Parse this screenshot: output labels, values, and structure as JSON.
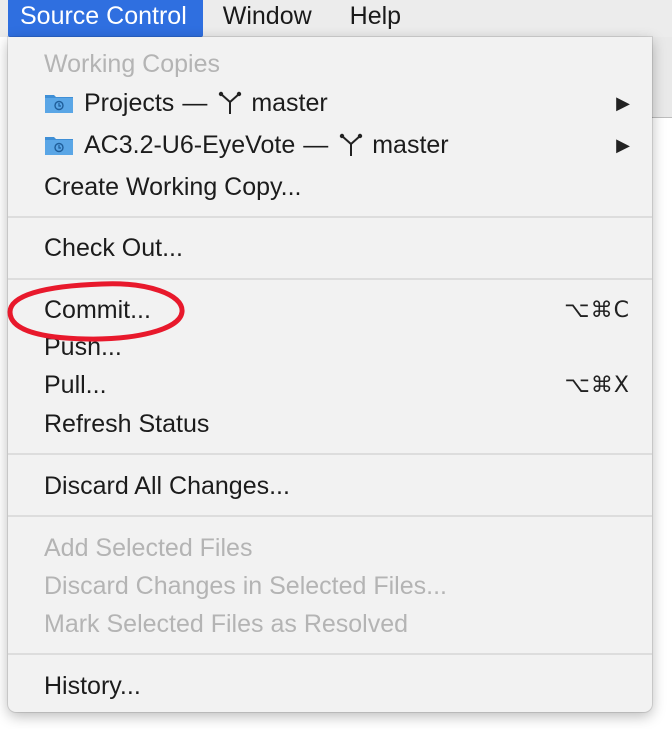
{
  "menubar": {
    "items": [
      {
        "label": "Source Control"
      },
      {
        "label": "Window"
      },
      {
        "label": "Help"
      }
    ]
  },
  "menu": {
    "sections": {
      "working_copies": {
        "header": "Working Copies",
        "repos": [
          {
            "name": "Projects",
            "dash": "—",
            "branch": "master"
          },
          {
            "name": "AC3.2-U6-EyeVote",
            "dash": "—",
            "branch": "master"
          }
        ],
        "create": "Create Working Copy..."
      },
      "checkout": "Check Out...",
      "remote": [
        {
          "label": "Commit...",
          "shortcut": "⌥⌘C"
        },
        {
          "label": "Push...",
          "shortcut": ""
        },
        {
          "label": "Pull...",
          "shortcut": "⌥⌘X"
        },
        {
          "label": "Refresh Status",
          "shortcut": ""
        }
      ],
      "discard_all": "Discard All Changes...",
      "file_actions": [
        "Add Selected Files",
        "Discard Changes in Selected Files...",
        "Mark Selected Files as Resolved"
      ],
      "history": "History..."
    }
  },
  "colors": {
    "selection_blue": "#2f6fe0",
    "folder_blue": "#3f8fd6",
    "annotation_red": "#e8192c",
    "disabled_text": "#b4b4b4"
  }
}
